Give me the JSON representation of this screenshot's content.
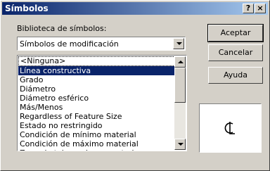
{
  "window": {
    "title": "Símbolos",
    "help_button": "?",
    "close_button": "×"
  },
  "library": {
    "label": "Biblioteca de símbolos:",
    "selected": "Símbolos de modificación"
  },
  "symbols_list": {
    "items": [
      "<Ninguna>",
      "Línea constructiva",
      "Grado",
      "Diámetro",
      "Diámetro esférico",
      "Más/Menos",
      "Regardless of Feature Size",
      "Estado no restringido",
      "Condición de mínimo material",
      "Condición de máximo material",
      "Zona de tolerancia proyectada"
    ],
    "selected_index": 1
  },
  "buttons": {
    "accept": "Aceptar",
    "cancel": "Cancelar",
    "help": "Ayuda"
  },
  "preview": {
    "symbol_icon": "centerline-icon",
    "color": "#000000"
  },
  "colors": {
    "titlebar_start": "#0a246a",
    "titlebar_end": "#a6caf0",
    "selection": "#0a246a",
    "face": "#d4d0c8"
  }
}
